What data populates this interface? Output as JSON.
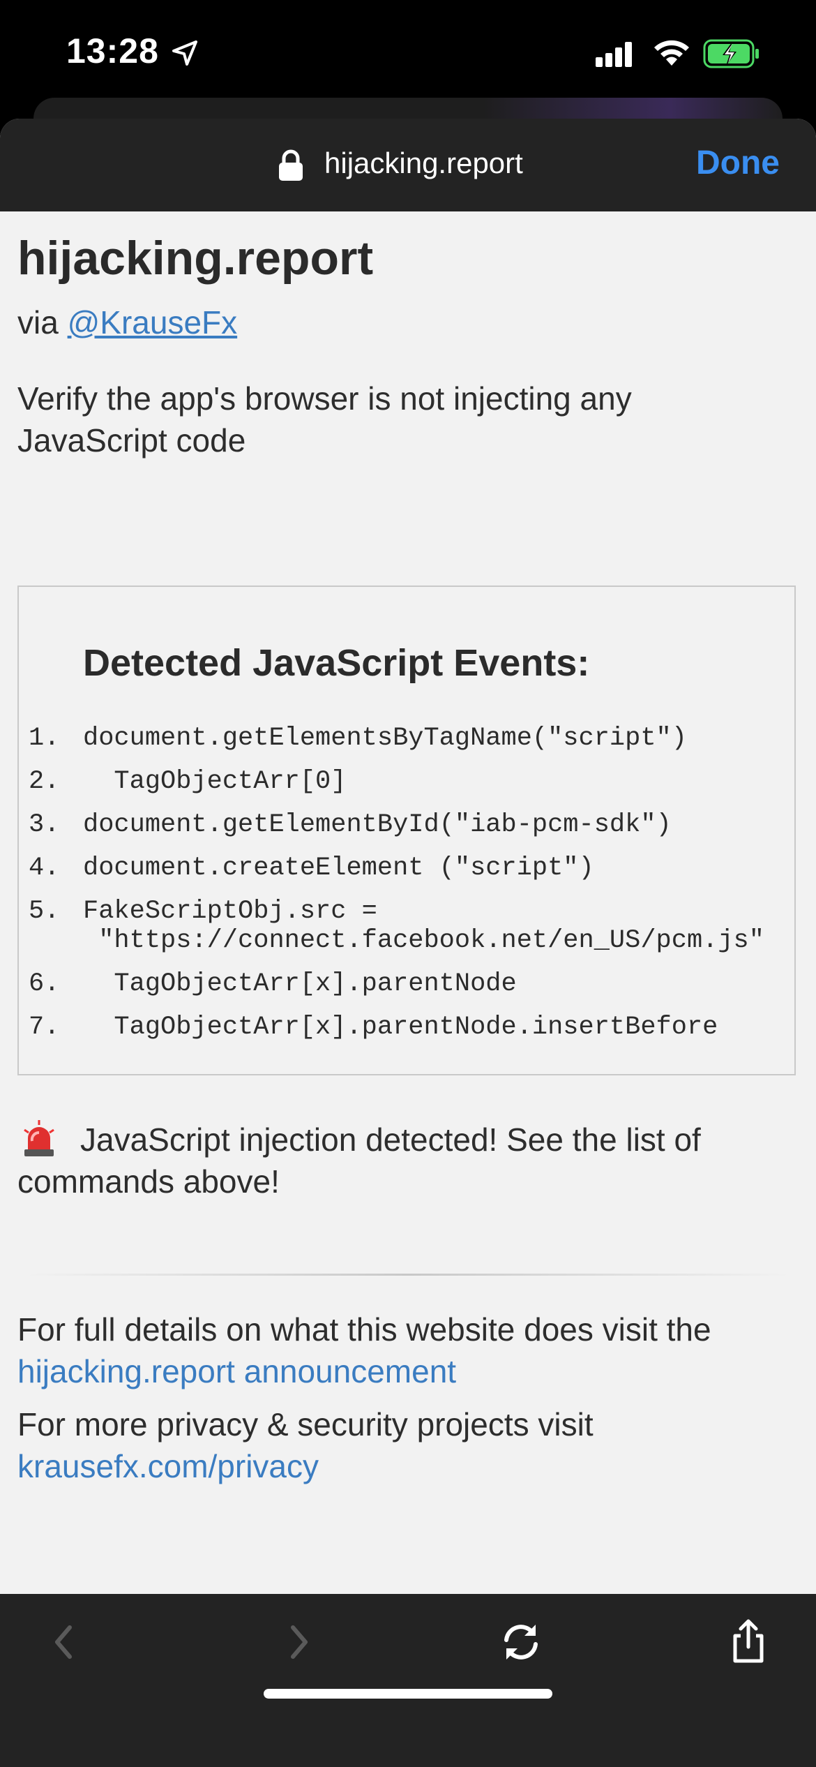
{
  "status_bar": {
    "time": "13:28"
  },
  "browser": {
    "url": "hijacking.report",
    "done_label": "Done"
  },
  "page": {
    "title": "hijacking.report",
    "via_prefix": "via",
    "via_link": "@KrauseFx",
    "intro": "Verify the app's browser is not injecting any JavaScript code",
    "events_title": "Detected JavaScript Events:",
    "events": [
      {
        "num": "1.",
        "text": "document.getElementsByTagName(\"script\")"
      },
      {
        "num": "2.",
        "text": "  TagObjectArr[0]"
      },
      {
        "num": "3.",
        "text": "document.getElementById(\"iab-pcm-sdk\")"
      },
      {
        "num": "4.",
        "text": "document.createElement (\"script\")"
      },
      {
        "num": "5.",
        "text": "FakeScriptObj.src =\n \"https://connect.facebook.net/en_US/pcm.js\""
      },
      {
        "num": "6.",
        "text": "  TagObjectArr[x].parentNode"
      },
      {
        "num": "7.",
        "text": "  TagObjectArr[x].parentNode.insertBefore"
      }
    ],
    "alert_text": "JavaScript injection detected! See the list of commands above!",
    "footer_1_text": "For full details on what this website does visit the",
    "footer_1_link": "hijacking.report announcement",
    "footer_2_text": "For more privacy & security projects visit",
    "footer_2_link": "krausefx.com/privacy"
  },
  "colors": {
    "link": "#3a7cc1",
    "done": "#3a8ef0",
    "battery": "#4cd964"
  },
  "icons": {
    "status": [
      "location-arrow-icon",
      "cellular-signal-icon",
      "wifi-icon",
      "battery-charging-icon"
    ],
    "header": [
      "lock-icon"
    ],
    "alert": [
      "siren-icon"
    ],
    "toolbar": [
      "back-chevron-icon",
      "forward-chevron-icon",
      "reload-icon",
      "share-icon"
    ]
  }
}
